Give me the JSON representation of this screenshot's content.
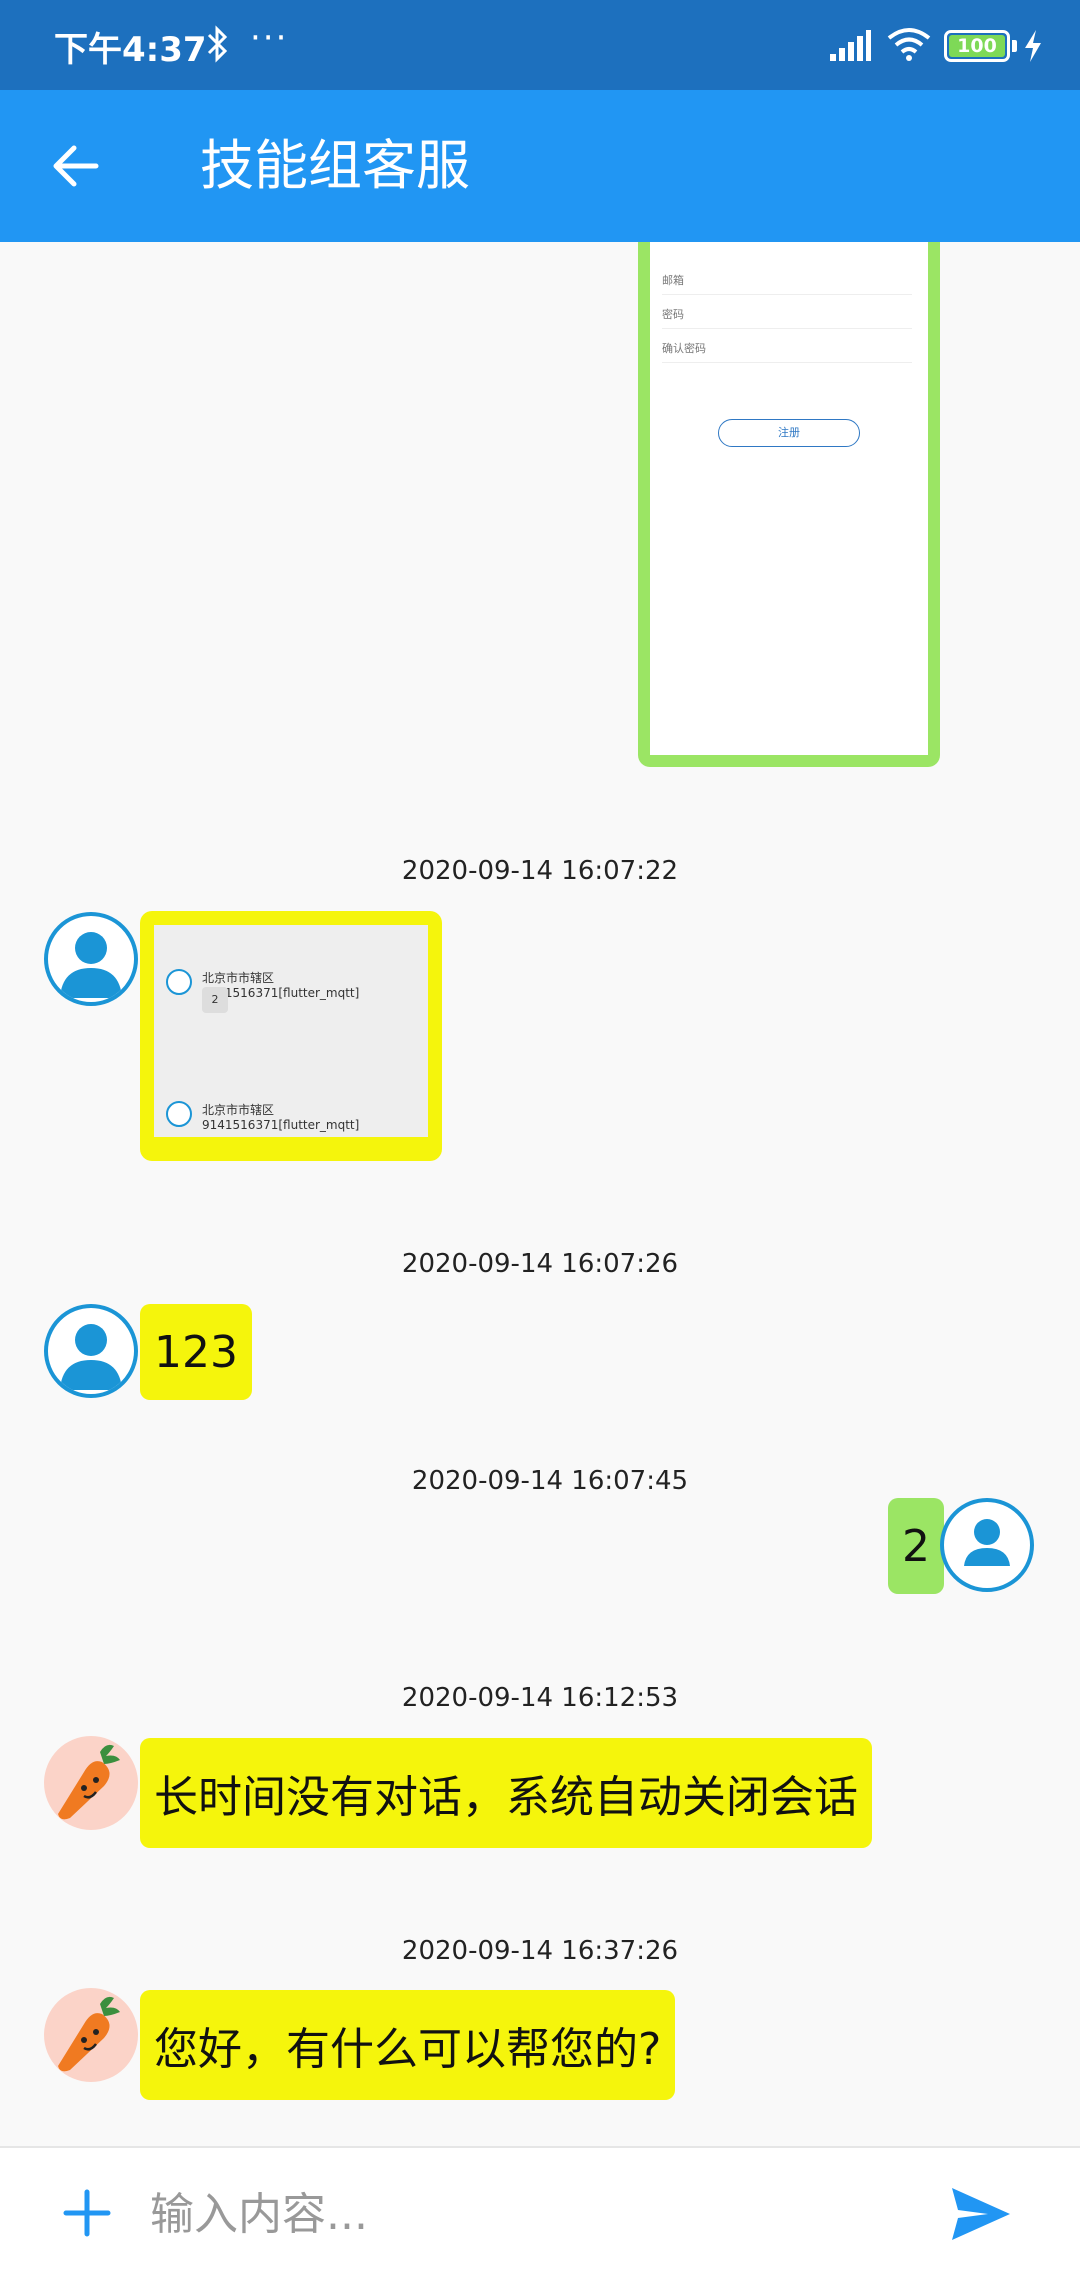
{
  "status_bar": {
    "time": "下午4:37",
    "dots": "···",
    "battery": "100"
  },
  "app_bar": {
    "title": "技能组客服"
  },
  "screenshot_preview": {
    "field1": "邮箱",
    "field2": "密码",
    "field3": "确认密码",
    "button": "注册"
  },
  "messages": [
    {
      "timestamp": "2020-09-14 16:07:22",
      "sender": "other",
      "type": "image",
      "image_line1": "北京市市辖区9141516371[flutter_mqtt]",
      "image_bubble1": "2",
      "image_line2": "北京市市辖区9141516371[flutter_mqtt]"
    },
    {
      "timestamp": "2020-09-14 16:07:26",
      "sender": "other",
      "type": "text",
      "text": "123"
    },
    {
      "timestamp": "2020-09-14 16:07:45",
      "sender": "me",
      "type": "text",
      "text": "2"
    },
    {
      "timestamp": "2020-09-14 16:12:53",
      "sender": "bot",
      "type": "text",
      "text": "长时间没有对话，系统自动关闭会话"
    },
    {
      "timestamp": "2020-09-14 16:37:26",
      "sender": "bot",
      "type": "text",
      "text": "您好，有什么可以帮您的?"
    }
  ],
  "input": {
    "placeholder": "输入内容..."
  },
  "colors": {
    "status_bar": "#1d70be",
    "app_bar": "#2196f3",
    "bubble_other": "#f5f50c",
    "bubble_me": "#9be564",
    "avatar_ring": "#1b95d6"
  },
  "icons": {
    "back": "arrow-left-icon",
    "add": "plus-icon",
    "send": "send-icon",
    "bluetooth": "bluetooth-icon",
    "signal": "signal-icon",
    "wifi": "wifi-icon",
    "charging": "lightning-icon"
  }
}
